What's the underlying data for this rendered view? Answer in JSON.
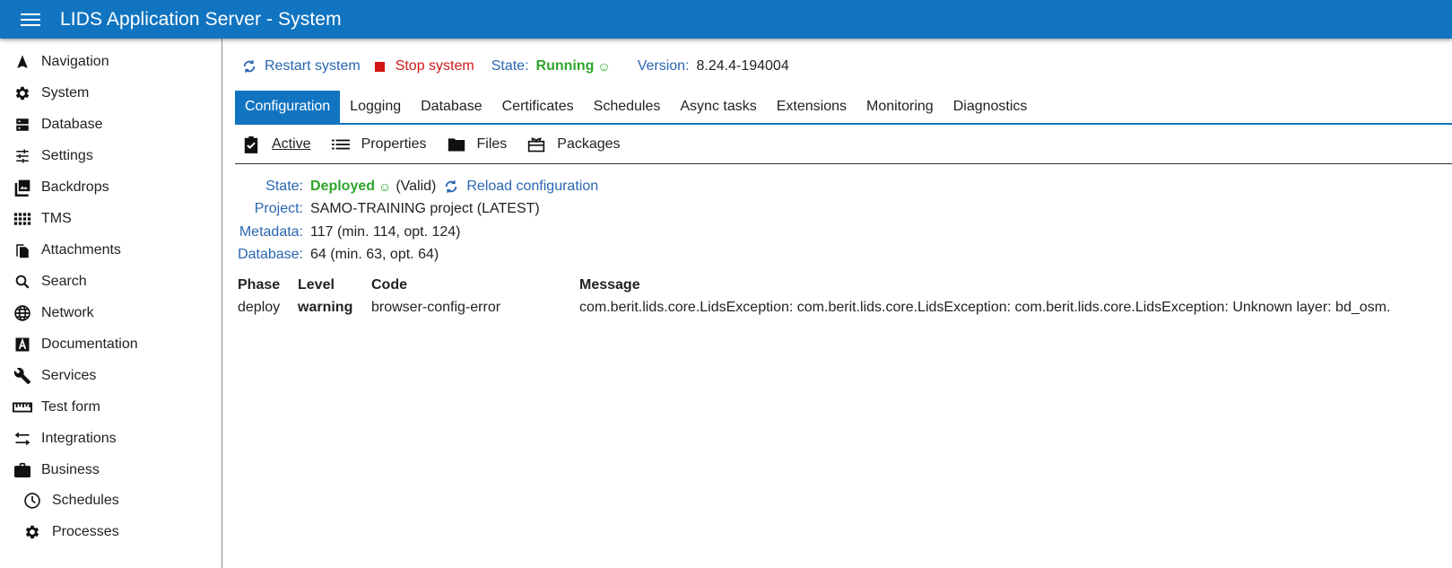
{
  "header": {
    "title": "LIDS Application Server - System",
    "menu_icon": "hamburger-menu-icon",
    "color": "#1174c0"
  },
  "sidebar": {
    "items": [
      {
        "label": "Navigation",
        "icon": "navigation-arrow-icon"
      },
      {
        "label": "System",
        "icon": "gear-icon"
      },
      {
        "label": "Database",
        "icon": "database-icon"
      },
      {
        "label": "Settings",
        "icon": "tune-sliders-icon"
      },
      {
        "label": "Backdrops",
        "icon": "image-stack-icon"
      },
      {
        "label": "TMS",
        "icon": "grid-dots-icon"
      },
      {
        "label": "Attachments",
        "icon": "file-copy-icon"
      },
      {
        "label": "Search",
        "icon": "search-icon"
      },
      {
        "label": "Network",
        "icon": "globe-icon"
      },
      {
        "label": "Documentation",
        "icon": "letter-a-icon"
      },
      {
        "label": "Services",
        "icon": "wrench-icon"
      },
      {
        "label": "Test form",
        "icon": "ruler-icon"
      },
      {
        "label": "Integrations",
        "icon": "swap-arrows-icon"
      },
      {
        "label": "Business",
        "icon": "briefcase-icon"
      },
      {
        "label": "Schedules",
        "icon": "clock-icon"
      },
      {
        "label": "Processes",
        "icon": "gear-icon"
      }
    ]
  },
  "toolbar": {
    "restart_label": "Restart system",
    "stop_label": "Stop system",
    "state_label": "State:",
    "state_value": "Running",
    "state_emoji": "☺",
    "version_label": "Version:",
    "version_value": "8.24.4-194004"
  },
  "tabs": [
    {
      "label": "Configuration",
      "active": true
    },
    {
      "label": "Logging"
    },
    {
      "label": "Database"
    },
    {
      "label": "Certificates"
    },
    {
      "label": "Schedules"
    },
    {
      "label": "Async tasks"
    },
    {
      "label": "Extensions"
    },
    {
      "label": "Monitoring"
    },
    {
      "label": "Diagnostics"
    }
  ],
  "subtabs": [
    {
      "label": "Active",
      "icon": "clipboard-check-icon",
      "active": true
    },
    {
      "label": "Properties",
      "icon": "list-icon"
    },
    {
      "label": "Files",
      "icon": "folder-icon"
    },
    {
      "label": "Packages",
      "icon": "package-icon"
    }
  ],
  "config": {
    "state_label": "State:",
    "state_value": "Deployed",
    "state_emoji": "☺",
    "state_validity": "(Valid)",
    "reload_label": "Reload configuration",
    "project_label": "Project:",
    "project_value": "SAMO-TRAINING project (LATEST)",
    "metadata_label": "Metadata:",
    "metadata_value": "117 (min. 114, opt. 124)",
    "database_label": "Database:",
    "database_value": "64 (min. 63, opt. 64)"
  },
  "issues": {
    "headers": {
      "phase": "Phase",
      "level": "Level",
      "code": "Code",
      "message": "Message"
    },
    "rows": [
      {
        "phase": "deploy",
        "level": "warning",
        "code": "browser-config-error",
        "message": "com.berit.lids.core.LidsException: com.berit.lids.core.LidsException: com.berit.lids.core.LidsException: Unknown layer: bd_osm."
      }
    ]
  },
  "colors": {
    "accent": "#1174c0",
    "link": "#2966b0",
    "ok": "#2fa52c",
    "warning": "#e07b25",
    "stop": "#d21414"
  }
}
